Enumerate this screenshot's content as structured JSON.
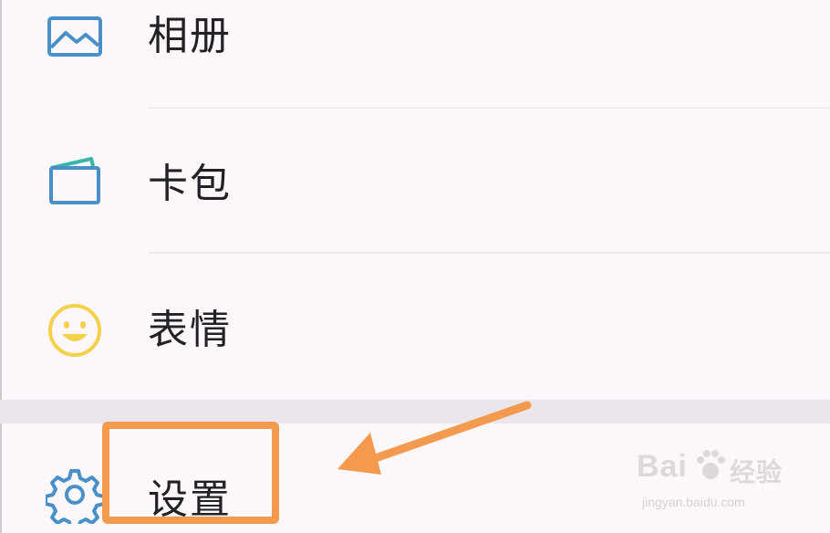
{
  "menu": {
    "items": [
      {
        "label": "相册",
        "icon": "photo-album-icon"
      },
      {
        "label": "卡包",
        "icon": "card-wallet-icon"
      },
      {
        "label": "表情",
        "icon": "smiley-icon"
      },
      {
        "label": "设置",
        "icon": "gear-icon"
      }
    ]
  },
  "watermark": {
    "brand": "Bai",
    "brand_cn": "经验",
    "url": "jingyan.baidu.com"
  },
  "colors": {
    "highlight": "#f39a4e",
    "icon_blue": "#4a90c8",
    "icon_teal": "#38b7a8",
    "icon_yellow": "#f5d04a"
  }
}
